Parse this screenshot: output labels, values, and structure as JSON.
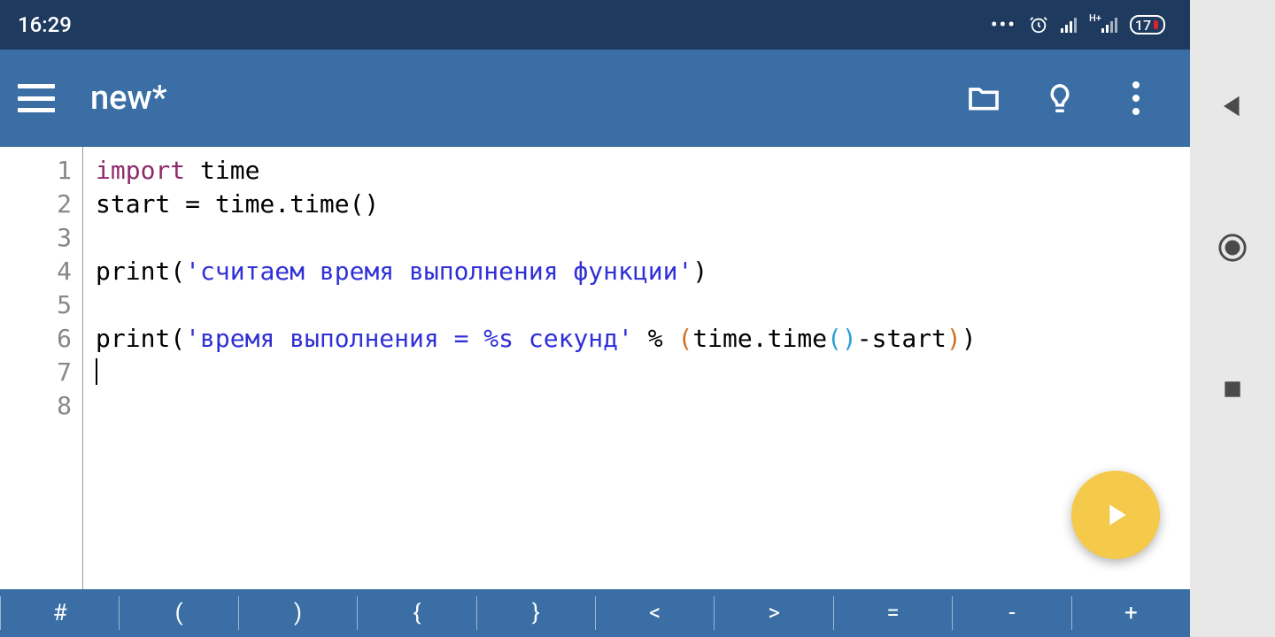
{
  "statusbar": {
    "time": "16:29",
    "battery": "17"
  },
  "appbar": {
    "title": "new*"
  },
  "editor": {
    "line_numbers": [
      "1",
      "2",
      "3",
      "4",
      "5",
      "6",
      "7",
      "8"
    ],
    "code": {
      "l1": {
        "kw": "import",
        "rest": " time"
      },
      "l2": "start = time.time()",
      "l4": {
        "fn": "print",
        "open": "(",
        "q1": "'",
        "str": "считаем время выполнения функции",
        "q2": "'",
        "close": ")"
      },
      "l6": {
        "fn": "print",
        "open": "(",
        "q1": "'",
        "str": "время выполнения = %s секунд",
        "q2": "'",
        "mid": " % ",
        "p2o": "(",
        "call": "time.time",
        "p3o": "(",
        "p3c": ")",
        "tail": "-start",
        "p2c": ")",
        "close": ")"
      }
    }
  },
  "symbar": [
    "#",
    "(",
    ")",
    "{",
    "}",
    "<",
    ">",
    "=",
    "-",
    "+"
  ],
  "icons": {
    "hamburger": "menu-icon",
    "folder": "folder-icon",
    "bulb": "lightbulb-icon",
    "overflow": "overflow-icon",
    "run": "play-icon",
    "back": "nav-back-icon",
    "home": "nav-home-icon",
    "recent": "nav-recent-icon",
    "alarm": "alarm-icon",
    "signal": "signal-icon",
    "battery": "battery-icon"
  }
}
